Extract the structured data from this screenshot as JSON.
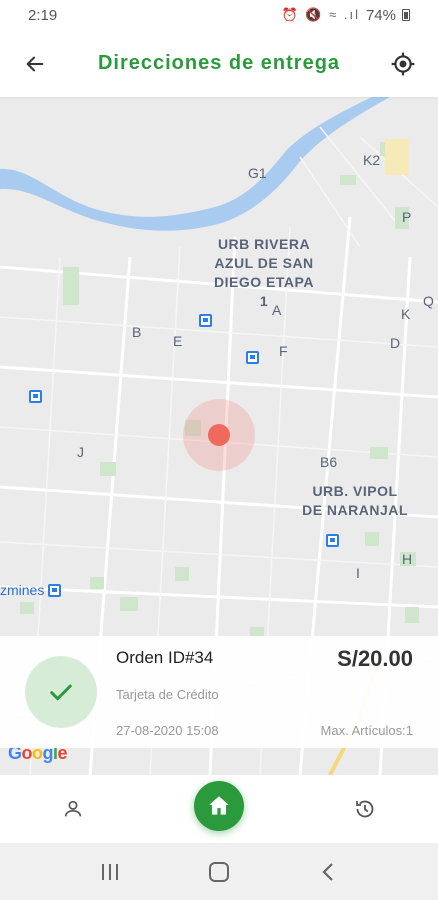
{
  "status_bar": {
    "time": "2:19",
    "battery": "74%"
  },
  "header": {
    "title": "Direcciones de entrega",
    "back_icon": "arrow-left-icon",
    "location_icon": "my-location-icon"
  },
  "map": {
    "labels": {
      "urb_rivera": [
        "URB RIVERA",
        "AZUL DE SAN",
        "DIEGO ETAPA 1"
      ],
      "urb_vipol": [
        "URB. VIPOL",
        "DE NARANJAL"
      ],
      "place": "zmines"
    },
    "letters": [
      "G1",
      "K2",
      "P",
      "A",
      "Q",
      "B",
      "E",
      "F",
      "K",
      "D",
      "J",
      "B6",
      "H",
      "I"
    ],
    "google": "Google"
  },
  "order": {
    "id": "Orden ID#34",
    "total": "S/20.00",
    "payment": "Tarjeta de Crédito",
    "date": "27-08-2020 15:08",
    "items": "Max. Artículos:1"
  },
  "nav": {
    "profile_icon": "user-icon",
    "home_icon": "home-icon",
    "history_icon": "history-icon"
  },
  "colors": {
    "brand": "#2a9a3c",
    "marker": "#ef6a5c",
    "map_label": "#5a6478"
  }
}
